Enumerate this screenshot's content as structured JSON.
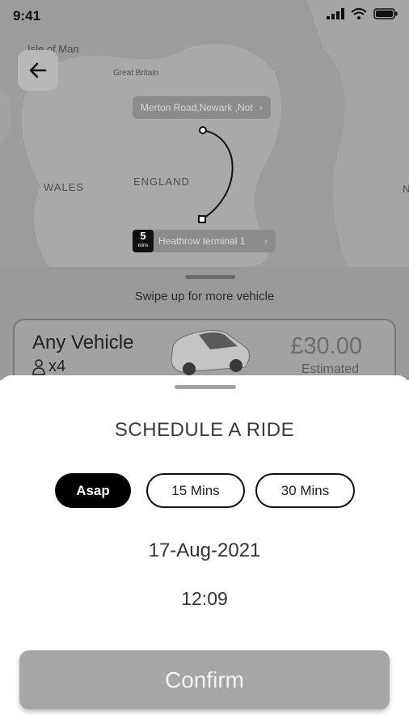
{
  "status_bar": {
    "time": "9:41"
  },
  "map": {
    "labels": {
      "isle_of_man": "Isle of Man",
      "great_britain": "Great Britain",
      "wales": "WALES",
      "england": "ENGLAND",
      "edge": "N"
    },
    "pickup": {
      "text": "Merton Road,Newark ,Nott"
    },
    "dropoff": {
      "text": "Heathrow terminal 1",
      "badge_value": "5",
      "badge_unit": "mins"
    }
  },
  "vehicle_panel": {
    "swipe_hint": "Swipe up for more vehicle",
    "vehicle": {
      "name": "Any Vehicle",
      "seats": "x4",
      "price": "£30.00",
      "price_note": "Estimated"
    }
  },
  "schedule": {
    "title": "SCHEDULE A RIDE",
    "options": [
      {
        "label": "Asap",
        "selected": true
      },
      {
        "label": "15 Mins",
        "selected": false
      },
      {
        "label": "30 Mins",
        "selected": false
      }
    ],
    "date": "17-Aug-2021",
    "time": "12:09",
    "confirm_label": "Confirm"
  },
  "colors": {
    "map_background": "#9c9c9c",
    "selected_chip": "#000000",
    "confirm_button": "#a6a6a6"
  },
  "icons": {
    "back": "arrow-left-icon",
    "signal": "signal-icon",
    "wifi": "wifi-icon",
    "battery": "battery-icon",
    "seat": "person-icon",
    "vehicle": "car-icon"
  }
}
